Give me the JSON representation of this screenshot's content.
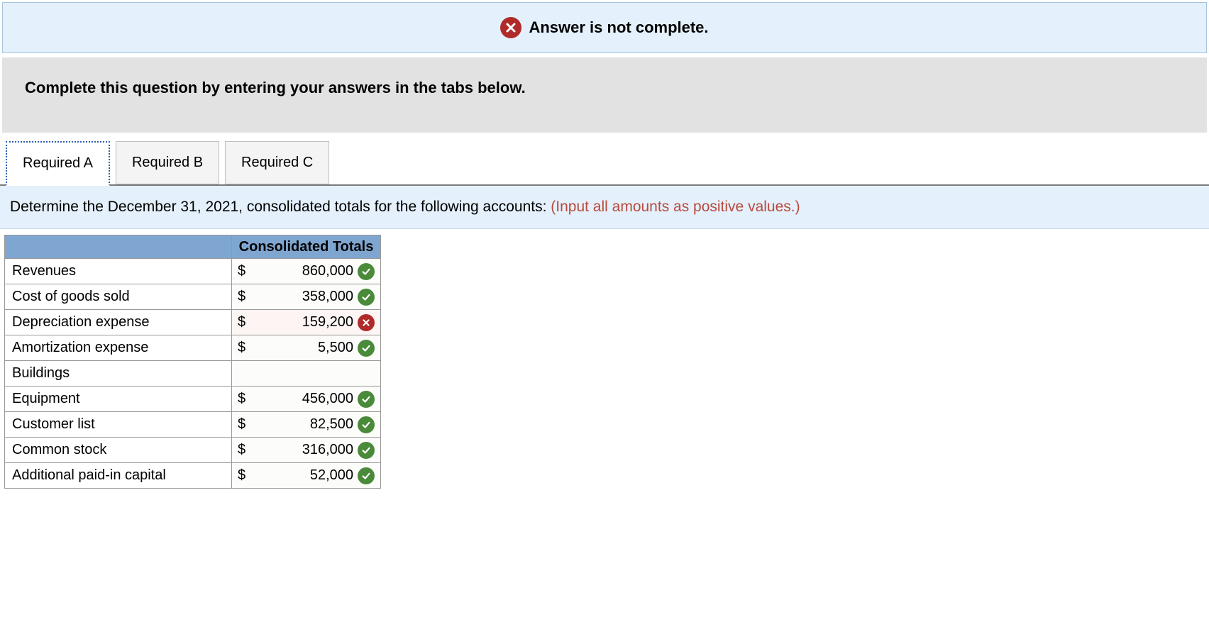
{
  "status": {
    "message": "Answer is not complete.",
    "icon": "x-icon"
  },
  "instruction": "Complete this question by entering your answers in the tabs below.",
  "tabs": [
    {
      "label": "Required A",
      "active": true
    },
    {
      "label": "Required B",
      "active": false
    },
    {
      "label": "Required C",
      "active": false
    }
  ],
  "prompt": {
    "text": "Determine the December 31, 2021, consolidated totals for the following accounts: ",
    "hint": "(Input all amounts as positive values.)"
  },
  "table": {
    "header": "Consolidated Totals",
    "rows": [
      {
        "label": "Revenues",
        "currency": "$",
        "value": "860,000",
        "status": "correct"
      },
      {
        "label": "Cost of goods sold",
        "currency": "$",
        "value": "358,000",
        "status": "correct"
      },
      {
        "label": "Depreciation expense",
        "currency": "$",
        "value": "159,200",
        "status": "incorrect"
      },
      {
        "label": "Amortization expense",
        "currency": "$",
        "value": "5,500",
        "status": "correct"
      },
      {
        "label": "Buildings",
        "currency": "",
        "value": "",
        "status": ""
      },
      {
        "label": "Equipment",
        "currency": "$",
        "value": "456,000",
        "status": "correct"
      },
      {
        "label": "Customer list",
        "currency": "$",
        "value": "82,500",
        "status": "correct"
      },
      {
        "label": "Common stock",
        "currency": "$",
        "value": "316,000",
        "status": "correct"
      },
      {
        "label": "Additional paid-in capital",
        "currency": "$",
        "value": "52,000",
        "status": "correct"
      }
    ]
  }
}
